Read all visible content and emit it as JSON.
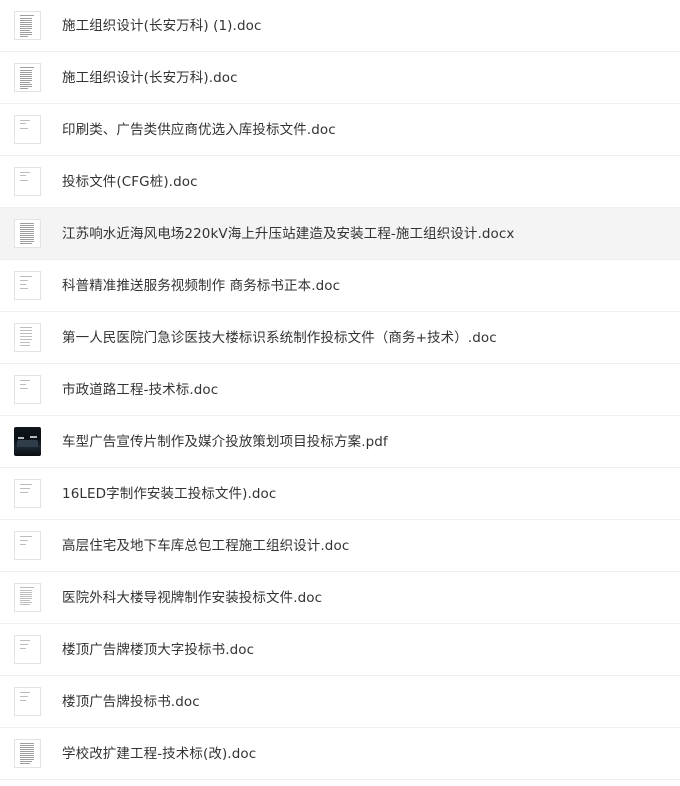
{
  "files": [
    {
      "name": "施工组织设计(长安万科) (1).doc",
      "icon": "document-thumbnail-icon",
      "highlighted": false
    },
    {
      "name": "施工组织设计(长安万科).doc",
      "icon": "document-thumbnail-icon",
      "highlighted": false
    },
    {
      "name": "印刷类、广告类供应商优选入库投标文件.doc",
      "icon": "document-thumbnail-icon",
      "highlighted": false
    },
    {
      "name": "投标文件(CFG桩).doc",
      "icon": "document-thumbnail-icon",
      "highlighted": false
    },
    {
      "name": "江苏响水近海风电场220kV海上升压站建造及安装工程-施工组织设计.docx",
      "icon": "document-thumbnail-icon",
      "highlighted": true
    },
    {
      "name": "科普精准推送服务视频制作 商务标书正本.doc",
      "icon": "document-thumbnail-icon",
      "highlighted": false
    },
    {
      "name": "第一人民医院门急诊医技大楼标识系统制作投标文件（商务+技术）.doc",
      "icon": "document-thumbnail-icon",
      "highlighted": false
    },
    {
      "name": "市政道路工程-技术标.doc",
      "icon": "document-thumbnail-icon",
      "highlighted": false
    },
    {
      "name": "车型广告宣传片制作及媒介投放策划项目投标方案.pdf",
      "icon": "pdf-photo-thumbnail-icon",
      "highlighted": false
    },
    {
      "name": "16LED字制作安装工投标文件).doc",
      "icon": "document-thumbnail-icon",
      "highlighted": false
    },
    {
      "name": "高层住宅及地下车库总包工程施工组织设计.doc",
      "icon": "document-thumbnail-icon",
      "highlighted": false
    },
    {
      "name": "医院外科大楼导视牌制作安装投标文件.doc",
      "icon": "document-thumbnail-icon",
      "highlighted": false
    },
    {
      "name": "楼顶广告牌楼顶大字投标书.doc",
      "icon": "document-thumbnail-icon",
      "highlighted": false
    },
    {
      "name": "楼顶广告牌投标书.doc",
      "icon": "document-thumbnail-icon",
      "highlighted": false
    },
    {
      "name": "学校改扩建工程-技术标(改).doc",
      "icon": "document-thumbnail-icon",
      "highlighted": false
    }
  ]
}
